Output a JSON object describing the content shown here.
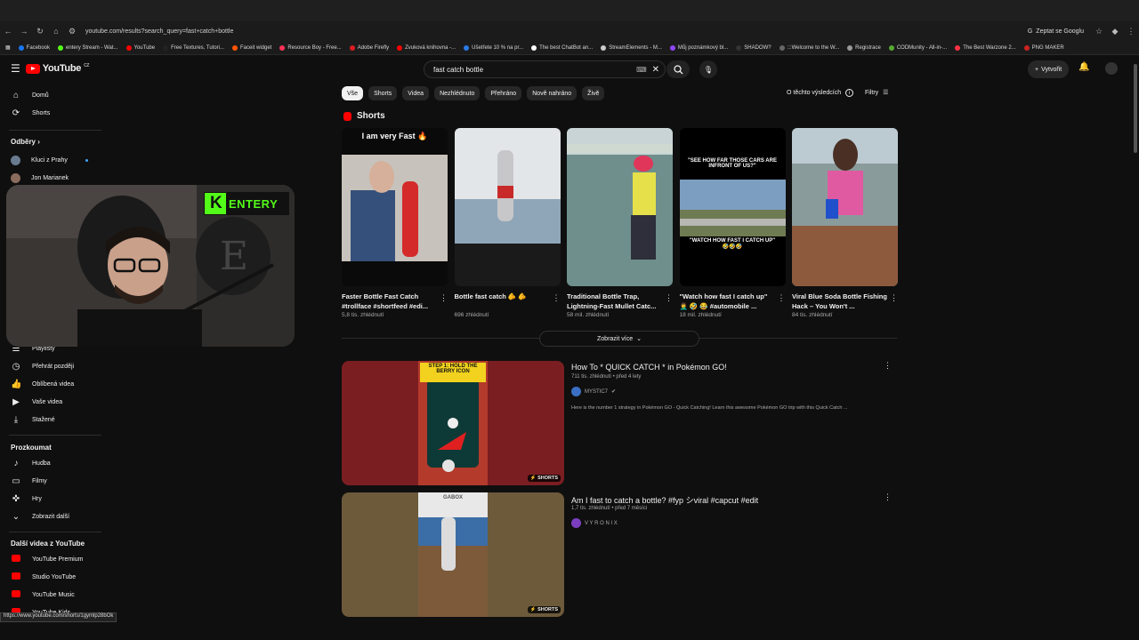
{
  "browser": {
    "url": "youtube.com/results?search_query=fast+catch+bottle",
    "ask_google": "Zeptat se Googlu",
    "bookmarks": [
      {
        "label": "Facebook",
        "color": "#1877f2"
      },
      {
        "label": "entery Stream - Wat...",
        "color": "#53fc18"
      },
      {
        "label": "YouTube",
        "color": "#ff0000"
      },
      {
        "label": "Free Textures, Tutori...",
        "color": "#222"
      },
      {
        "label": "Faceit widget",
        "color": "#ff5500"
      },
      {
        "label": "Resource Boy - Free...",
        "color": "#ff3355"
      },
      {
        "label": "Adobe Firefly",
        "color": "#e01b22"
      },
      {
        "label": "Zvuková knihovna -...",
        "color": "#ff0000"
      },
      {
        "label": "Ušetřete 10 % na pr...",
        "color": "#2a7be4"
      },
      {
        "label": "The best ChatBot an...",
        "color": "#ffffff"
      },
      {
        "label": "StreamElements - M...",
        "color": "#cccccc"
      },
      {
        "label": "Můj poznámkový bl...",
        "color": "#9146ff"
      },
      {
        "label": "SHADOW?",
        "color": "#333"
      },
      {
        "label": ":::Welcome to the W...",
        "color": "#666"
      },
      {
        "label": "Registrace",
        "color": "#999"
      },
      {
        "label": "CODMunity - All-in-...",
        "color": "#55aa33"
      },
      {
        "label": "The Best Warzone 2...",
        "color": "#ff3344"
      },
      {
        "label": "PNG MAKER",
        "color": "#cc2222"
      }
    ],
    "status_url": "https://www.youtube.com/shorts/1gymlp28bOk"
  },
  "header": {
    "logo_text": "YouTube",
    "country": "CZ",
    "search_value": "fast catch bottle",
    "create_label": "Vytvořit"
  },
  "sidebar": {
    "top": [
      {
        "label": "Domů",
        "icon": "home-icon"
      },
      {
        "label": "Shorts",
        "icon": "shorts-icon"
      }
    ],
    "subs_title": "Odběry",
    "subs": [
      {
        "label": "Kluci z Prahy"
      },
      {
        "label": "Jon Marianek"
      }
    ],
    "you": [
      {
        "label": "Playlisty",
        "icon": "playlist-icon"
      },
      {
        "label": "Přehrát později",
        "icon": "clock-icon"
      },
      {
        "label": "Oblíbená videa",
        "icon": "thumbs-up-icon"
      },
      {
        "label": "Vaše videa",
        "icon": "video-icon"
      },
      {
        "label": "Stažené",
        "icon": "download-icon"
      }
    ],
    "explore_title": "Prozkoumat",
    "explore": [
      {
        "label": "Hudba",
        "icon": "music-icon"
      },
      {
        "label": "Filmy",
        "icon": "film-icon"
      },
      {
        "label": "Hry",
        "icon": "gamepad-icon"
      },
      {
        "label": "Zobrazit další",
        "icon": "chevron-down-icon"
      }
    ],
    "more_title": "Další videa z YouTube",
    "more": [
      {
        "label": "YouTube Premium"
      },
      {
        "label": "Studio YouTube"
      },
      {
        "label": "YouTube Music"
      },
      {
        "label": "YouTube Kids"
      }
    ]
  },
  "chips": [
    "Vše",
    "Shorts",
    "Videa",
    "Nezhlédnuto",
    "Přehráno",
    "Nově nahráno",
    "Živě"
  ],
  "about_results": "O těchto výsledcích",
  "filters_label": "Filtry",
  "shorts_section": {
    "title": "Shorts",
    "items": [
      {
        "title": "Faster Bottle Fast Catch #trollface #shortfeed #edi...",
        "views": "5,8 tis. zhlédnutí",
        "overlay": "I am very Fast 🔥"
      },
      {
        "title": "Bottle fast catch 🫵 🫵",
        "views": "696 zhlédnutí",
        "overlay": ""
      },
      {
        "title": "Traditional Bottle Trap, Lightning-Fast Mullet Catc...",
        "views": "58 mil. zhlédnutí",
        "overlay": ""
      },
      {
        "title": "\"Watch how fast I catch up\" 🤦‍♂️ 🤣 😂 #automobile ...",
        "views": "18 mil. zhlédnutí",
        "overlay": "\"SEE HOW FAR THOSE CARS ARE INFRONT OF US?\"",
        "overlay2": "\"WATCH HOW FAST I CATCH UP\" 🤣🤣🤣"
      },
      {
        "title": "Viral Blue Soda Bottle Fishing Hack – You Won't ...",
        "views": "84 tis. zhlédnutí",
        "overlay": ""
      }
    ],
    "show_more": "Zobrazit více"
  },
  "videos": [
    {
      "title": "How To * QUICK CATCH * in Pokémon GO!",
      "meta": "711 tis. zhlédnutí • před 4 lety",
      "channel": "MYSTIC7",
      "desc": "Here is the number 1 strategy in Pokémon GO - Quick Catching! Learn this awesome Pokémon GO trip with this Quick Catch ...",
      "badge": "SHORTS",
      "thumb_text": "STEP 1: HOLD THE BERRY ICON"
    },
    {
      "title": "Am I fast to catch a bottle? #fyp シviral #capcut #edit",
      "meta": "1,7 tis. zhlédnutí • před 7 měsíci",
      "channel": "V Y R O N I X",
      "desc": "",
      "badge": "SHORTS",
      "thumb_text": "GABOX"
    }
  ],
  "webcam": {
    "logo_text": "ENTERY",
    "logo_letter": "K"
  }
}
